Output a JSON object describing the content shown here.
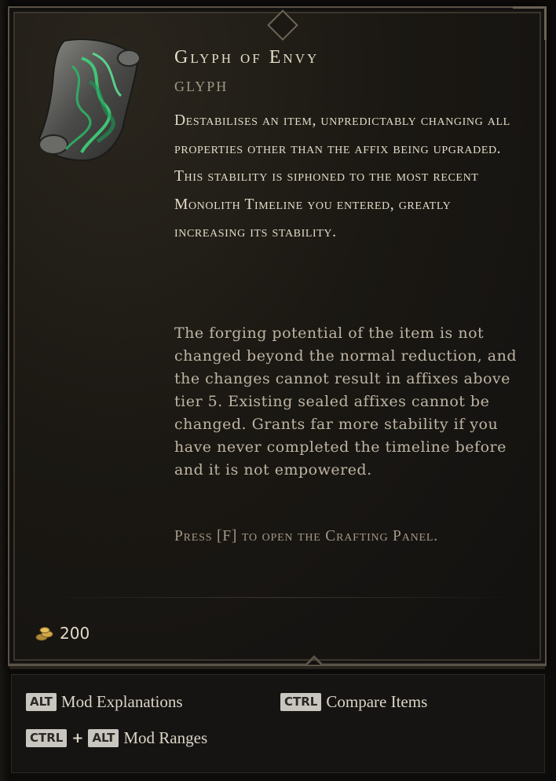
{
  "item": {
    "name": "Glyph of Envy",
    "type": "GLYPH",
    "icon": "scroll-glyph-icon",
    "description": "Destabilises an item, unpredictably changing all properties other than the affix being upgraded. This stability is siphoned to the most recent Monolith Timeline you entered, greatly increasing its stability.",
    "details": "The forging potential of the item is not changed beyond the normal reduction, and the changes cannot result in affixes above tier 5. Existing sealed affixes cannot be changed. Grants far more stability if you have never completed the timeline before and it is not empowered.",
    "press_hint": "Press [F] to open the Crafting Panel.",
    "price": "200",
    "price_icon": "gold-coin-icon"
  },
  "footer": {
    "hints": [
      {
        "keys": [
          "ALT"
        ],
        "label": "Mod Explanations"
      },
      {
        "keys": [
          "CTRL"
        ],
        "label": "Compare Items"
      },
      {
        "keys": [
          "CTRL",
          "ALT"
        ],
        "plus": "+",
        "label": "Mod Ranges"
      }
    ]
  },
  "colors": {
    "title": "#e6dcc6",
    "text": "#e3dbc8",
    "muted": "#a39886",
    "glyph_green": "#3fd17a",
    "frame": "#5a5346"
  }
}
